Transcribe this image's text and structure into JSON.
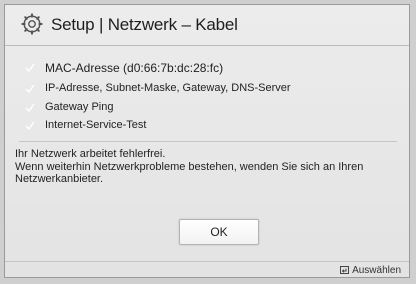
{
  "dialog": {
    "title": "Setup | Netzwerk – Kabel",
    "checks": [
      {
        "label": "MAC-Adresse (d0:66:7b:dc:28:fc)"
      },
      {
        "label": "IP-Adresse, Subnet-Maske, Gateway, DNS-Server"
      },
      {
        "label": "Gateway Ping"
      },
      {
        "label": "Internet-Service-Test"
      }
    ],
    "message_line1": "Ihr Netzwerk arbeitet fehlerfrei.",
    "message_line2": "Wenn weiterhin Netzwerkprobleme bestehen, wenden Sie sich an Ihren Netzwerkanbieter.",
    "ok_label": "OK",
    "footer_hint": "Auswählen",
    "icons": {
      "header": "gear-icon",
      "check": "checkmark-icon",
      "footer": "enter-icon"
    },
    "colors": {
      "background": "#ececec",
      "text": "#1e1e1e",
      "check": "#ffffff"
    }
  }
}
